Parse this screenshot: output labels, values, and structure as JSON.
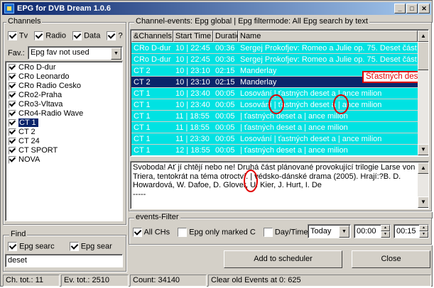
{
  "window": {
    "title": "EPG for DVB Dream 1.0.6"
  },
  "channels_panel": {
    "label": "Channels",
    "filters": [
      {
        "label": "Tv",
        "checked": true
      },
      {
        "label": "Radio",
        "checked": true
      },
      {
        "label": "Data",
        "checked": true
      },
      {
        "label": "?",
        "checked": true
      }
    ],
    "fav_label": "Fav.:",
    "fav_value": "Epg fav not used",
    "items": [
      {
        "label": "CRo D-dur",
        "checked": true
      },
      {
        "label": "CRo Leonardo",
        "checked": true
      },
      {
        "label": "CRo Radio Cesko",
        "checked": true
      },
      {
        "label": "CRo2-Praha",
        "checked": true
      },
      {
        "label": "CRo3-Vltava",
        "checked": true
      },
      {
        "label": "CRo4-Radio Wave",
        "checked": true
      },
      {
        "label": "CT 1",
        "checked": true,
        "selected": true
      },
      {
        "label": "CT 2",
        "checked": true
      },
      {
        "label": "CT 24",
        "checked": true
      },
      {
        "label": "CT SPORT",
        "checked": true
      },
      {
        "label": "NOVA",
        "checked": true
      }
    ]
  },
  "find_panel": {
    "label": "Find",
    "option1": {
      "label": "Epg searc",
      "checked": true
    },
    "option2": {
      "label": "Epg sear",
      "checked": true
    },
    "query": "deset"
  },
  "events_panel": {
    "header": "Channel-events: Epg global | Epg filtermode: All Epg search by text",
    "columns": [
      "&Channels",
      "Start Time",
      "Duratio",
      "Name"
    ],
    "rows": [
      {
        "channel": "CRo D-dur",
        "start": "10 | 22:45",
        "duration": "00:36",
        "name": "Sergej Prokofjev: Romeo a Julie op. 75. Deset částí z"
      },
      {
        "channel": "CRo D-dur",
        "start": "10 | 22:45",
        "duration": "00:36",
        "name": "Sergej Prokofjev: Romeo a Julie op. 75. Deset částí z"
      },
      {
        "channel": "CT 2",
        "start": "10 | 23:10",
        "duration": "02:15",
        "name": "Manderlay"
      },
      {
        "channel": "CT 2",
        "start": "10 | 23:10",
        "duration": "02:15",
        "name": "Manderlay",
        "selected": true
      },
      {
        "channel": "CT 1",
        "start": "10 | 23:40",
        "duration": "00:05",
        "name": "Losování  | ťastných deset a  | ance milion"
      },
      {
        "channel": "CT 1",
        "start": "10 | 23:40",
        "duration": "00:05",
        "name": "Losování  | ťastných deset a  | ance milion"
      },
      {
        "channel": "CT 1",
        "start": "11 | 18:55",
        "duration": "00:05",
        "name": " | ťastných deset a  | ance milion"
      },
      {
        "channel": "CT 1",
        "start": "11 | 18:55",
        "duration": "00:05",
        "name": " | ťastných deset a  | ance milion"
      },
      {
        "channel": "CT 1",
        "start": "11 | 23:30",
        "duration": "00:05",
        "name": "Losování  | ťastných deset a  | ance milion"
      },
      {
        "channel": "CT 1",
        "start": "12 | 18:55",
        "duration": "00:05",
        "name": " | ťastných deset a  | ance milion"
      }
    ],
    "callout": "Šťastných deset a Šance milion",
    "description": "Svoboda! Ať jí chtějí nebo ne! Druhá část plánované provokující trilogie Larse von Trierа, tentokrát na téma otroctví. | védsko-dánské drama (2005). Hrají:?B. D. Howardová, W. Dafoe, D. Glover, U. Kier, J. Hurt, I. De\n-----"
  },
  "events_filter": {
    "label": "events-Filter",
    "all_chs": {
      "label": "All CHs",
      "checked": true
    },
    "only_marked": {
      "label": "Epg only marked C",
      "checked": false
    },
    "daytime": {
      "label": "Day/Time",
      "checked": false
    },
    "day_value": "Today",
    "time_from": "00:00",
    "time_to": "00:15"
  },
  "buttons": {
    "add": "Add to scheduler",
    "close": "Close"
  },
  "status": {
    "ch_total": "Ch. tot.: 11",
    "ev_total": "Ev. tot.: 2510",
    "count": "Count: 34140",
    "clear": "Clear old Events at 0: 625"
  },
  "colors": {
    "row_bg": "#00e2e2",
    "selected_bg": "#0a246a",
    "annotation_red": "#e00000"
  }
}
